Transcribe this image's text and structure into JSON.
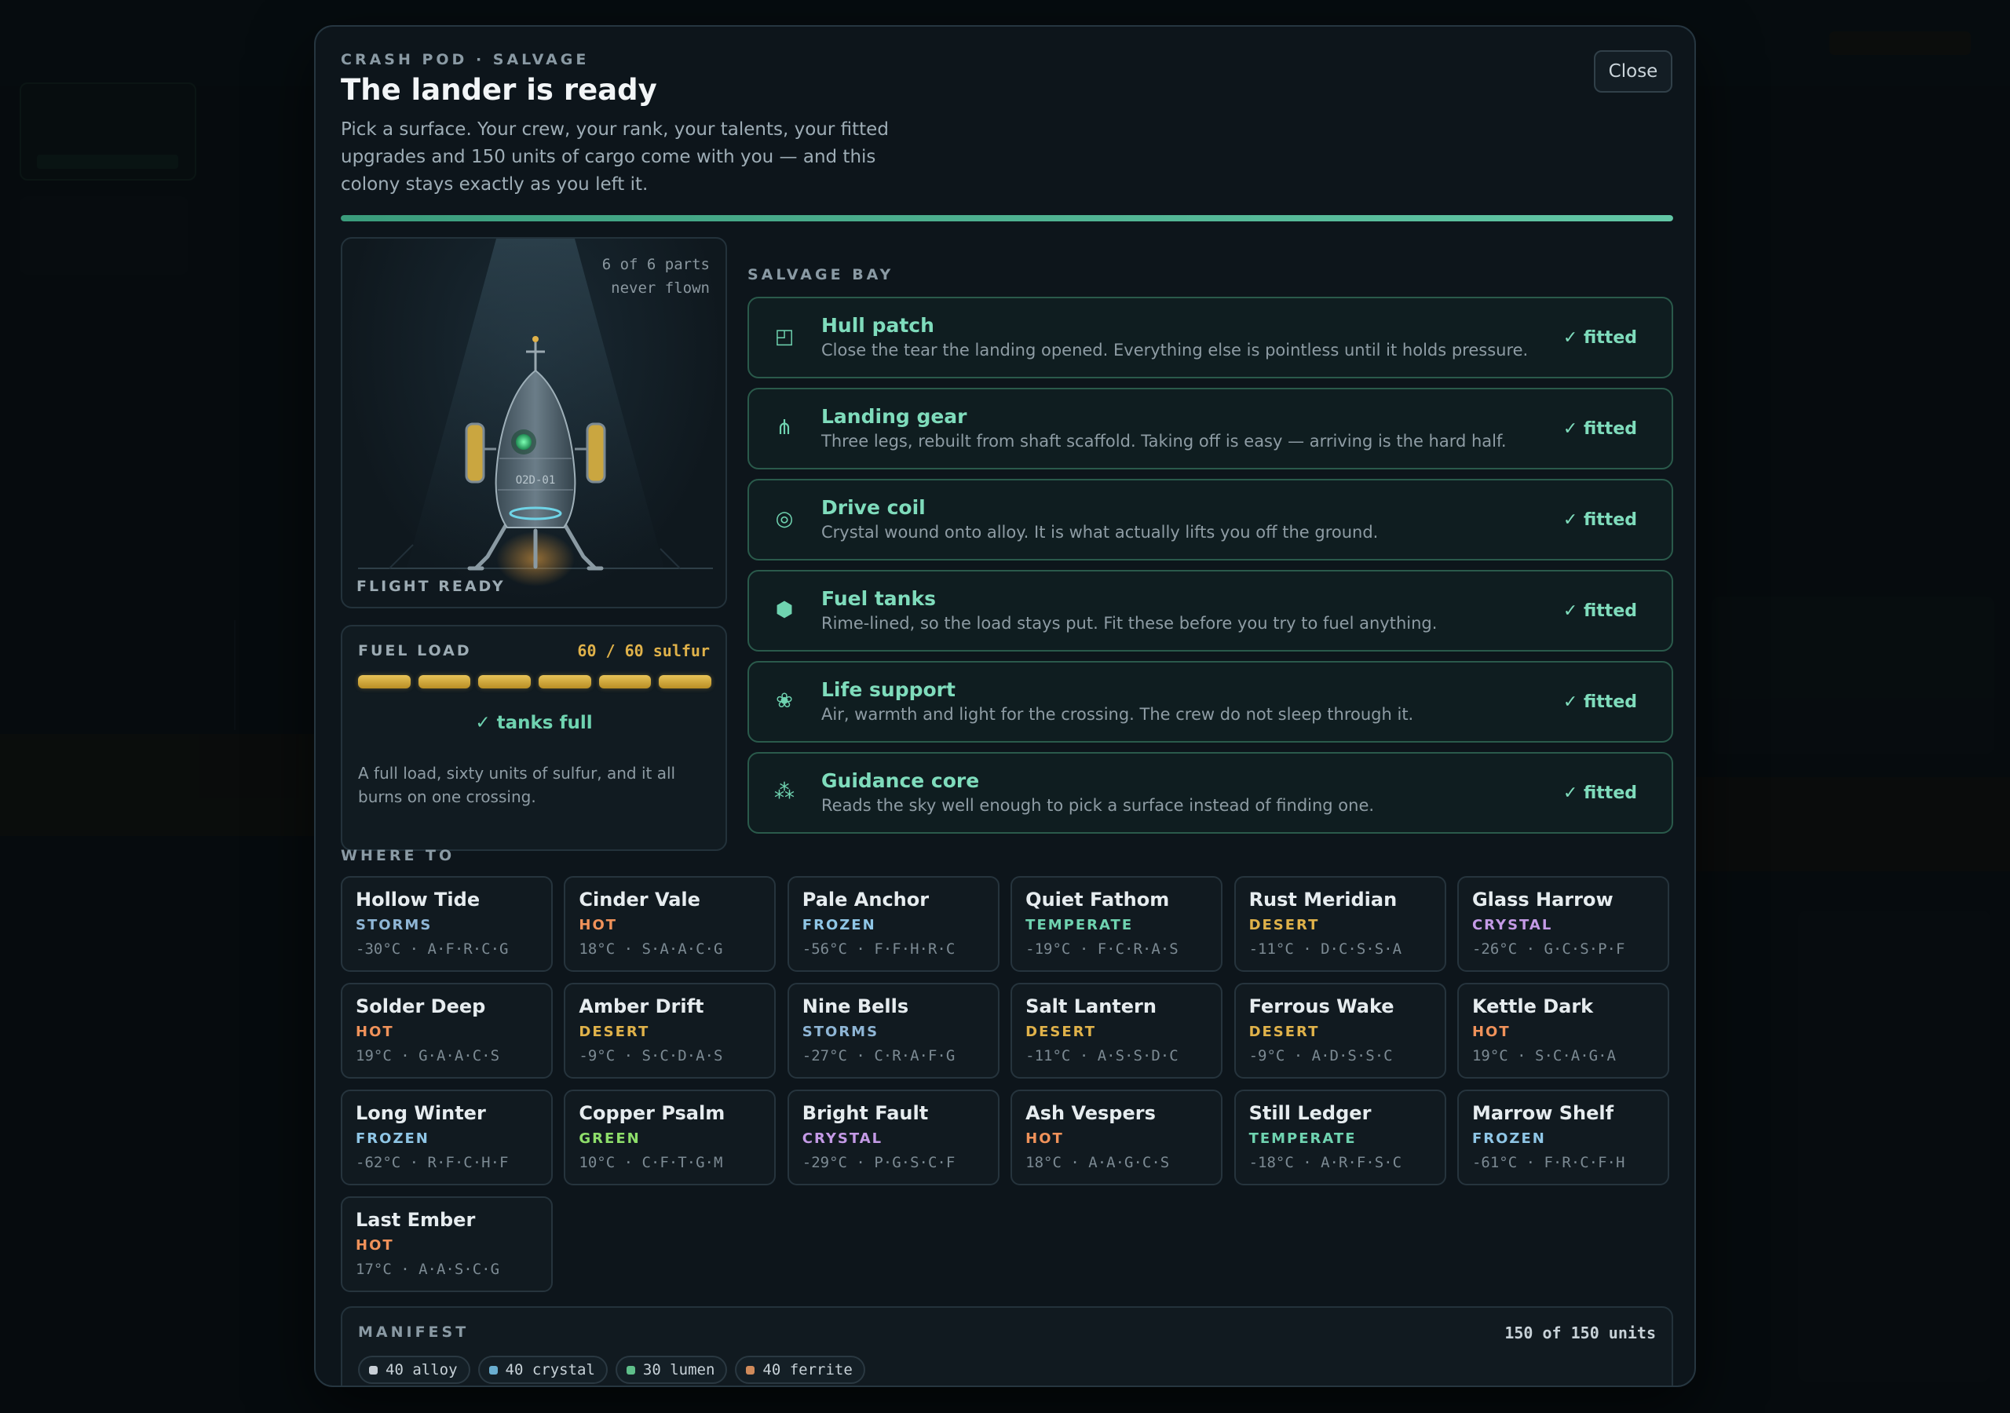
{
  "modal": {
    "kicker": "CRASH POD · SALVAGE",
    "title": "The lander is ready",
    "subtitle": "Pick a surface. Your crew, your rank, your talents, your fitted upgrades and 150 units of cargo come with you — and this colony stays exactly as you left it.",
    "close_label": "Close",
    "progress_fraction": 1.0
  },
  "lander": {
    "parts_count": "6 of 6 parts",
    "flight_status_note": "never flown",
    "hull_label": "O2D-01",
    "state_label": "FLIGHT READY"
  },
  "fuel": {
    "label": "FUEL LOAD",
    "amount": "60 / 60 sulfur",
    "cells_total": 6,
    "cells_filled": 6,
    "status": "✓ tanks full",
    "note": "A full load, sixty units of sulfur, and it all burns on one crossing."
  },
  "salvage_bay": {
    "label": "SALVAGE BAY",
    "parts": [
      {
        "icon": "hull-patch-icon",
        "glyph": "◰",
        "name": "Hull patch",
        "desc": "Close the tear the landing opened. Everything else is pointless until it holds pressure.",
        "status": "✓ fitted"
      },
      {
        "icon": "landing-gear-icon",
        "glyph": "⋔",
        "name": "Landing gear",
        "desc": "Three legs, rebuilt from shaft scaffold. Taking off is easy — arriving is the hard half.",
        "status": "✓ fitted"
      },
      {
        "icon": "drive-coil-icon",
        "glyph": "◎",
        "name": "Drive coil",
        "desc": "Crystal wound onto alloy. It is what actually lifts you off the ground.",
        "status": "✓ fitted"
      },
      {
        "icon": "fuel-tank-icon",
        "glyph": "⬢",
        "name": "Fuel tanks",
        "desc": "Rime-lined, so the load stays put. Fit these before you try to fuel anything.",
        "status": "✓ fitted"
      },
      {
        "icon": "life-support-icon",
        "glyph": "❀",
        "name": "Life support",
        "desc": "Air, warmth and light for the crossing. The crew do not sleep through it.",
        "status": "✓ fitted"
      },
      {
        "icon": "guidance-core-icon",
        "glyph": "⁂",
        "name": "Guidance core",
        "desc": "Reads the sky well enough to pick a surface instead of finding one.",
        "status": "✓ fitted"
      }
    ]
  },
  "destinations": {
    "label": "WHERE TO",
    "type_colors": {
      "STORMS": "#8fb6d6",
      "HOT": "#f0925a",
      "FROZEN": "#8fc6e6",
      "TEMPERATE": "#6fd3b0",
      "DESERT": "#e0b24a",
      "CRYSTAL": "#c49ae6",
      "GREEN": "#8ede6a"
    },
    "items": [
      {
        "name": "Hollow Tide",
        "type": "STORMS",
        "temp": "-30°C",
        "codes": "A·F·R·C·G"
      },
      {
        "name": "Cinder Vale",
        "type": "HOT",
        "temp": "18°C",
        "codes": "S·A·A·C·G"
      },
      {
        "name": "Pale Anchor",
        "type": "FROZEN",
        "temp": "-56°C",
        "codes": "F·F·H·R·C"
      },
      {
        "name": "Quiet Fathom",
        "type": "TEMPERATE",
        "temp": "-19°C",
        "codes": "F·C·R·A·S"
      },
      {
        "name": "Rust Meridian",
        "type": "DESERT",
        "temp": "-11°C",
        "codes": "D·C·S·S·A"
      },
      {
        "name": "Glass Harrow",
        "type": "CRYSTAL",
        "temp": "-26°C",
        "codes": "G·C·S·P·F"
      },
      {
        "name": "Solder Deep",
        "type": "HOT",
        "temp": "19°C",
        "codes": "G·A·A·C·S"
      },
      {
        "name": "Amber Drift",
        "type": "DESERT",
        "temp": "-9°C",
        "codes": "S·C·D·A·S"
      },
      {
        "name": "Nine Bells",
        "type": "STORMS",
        "temp": "-27°C",
        "codes": "C·R·A·F·G"
      },
      {
        "name": "Salt Lantern",
        "type": "DESERT",
        "temp": "-11°C",
        "codes": "A·S·S·D·C"
      },
      {
        "name": "Ferrous Wake",
        "type": "DESERT",
        "temp": "-9°C",
        "codes": "A·D·S·S·C"
      },
      {
        "name": "Kettle Dark",
        "type": "HOT",
        "temp": "19°C",
        "codes": "S·C·A·G·A"
      },
      {
        "name": "Long Winter",
        "type": "FROZEN",
        "temp": "-62°C",
        "codes": "R·F·C·H·F"
      },
      {
        "name": "Copper Psalm",
        "type": "GREEN",
        "temp": "10°C",
        "codes": "C·F·T·G·M"
      },
      {
        "name": "Bright Fault",
        "type": "CRYSTAL",
        "temp": "-29°C",
        "codes": "P·G·S·C·F"
      },
      {
        "name": "Ash Vespers",
        "type": "HOT",
        "temp": "18°C",
        "codes": "A·A·G·C·S"
      },
      {
        "name": "Still Ledger",
        "type": "TEMPERATE",
        "temp": "-18°C",
        "codes": "A·R·F·S·C"
      },
      {
        "name": "Marrow Shelf",
        "type": "FROZEN",
        "temp": "-61°C",
        "codes": "F·R·C·F·H"
      },
      {
        "name": "Last Ember",
        "type": "HOT",
        "temp": "17°C",
        "codes": "A·A·S·C·G"
      }
    ]
  },
  "manifest": {
    "label": "MANIFEST",
    "total": "150 of 150 units",
    "cargo": [
      {
        "label": "40 alloy",
        "color": "#c8cfd6"
      },
      {
        "label": "40 crystal",
        "color": "#6aaed0"
      },
      {
        "label": "30 lumen",
        "color": "#5fbf8a"
      },
      {
        "label": "40 ferrite",
        "color": "#d08a5a"
      }
    ]
  }
}
